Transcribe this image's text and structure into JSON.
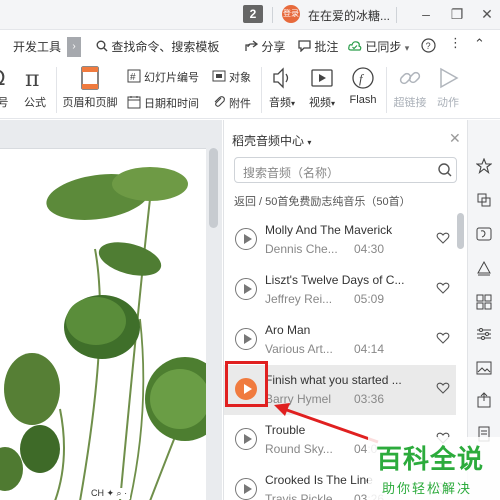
{
  "titlebar": {
    "window_count": "2",
    "avatar_text": "登录",
    "doc_title": "在在爱的冰糖..."
  },
  "menubar": {
    "dev_tools": "开发工具",
    "search_command": "查找命令、搜索模板",
    "share": "分享",
    "comment": "批注",
    "synced": "已同步"
  },
  "ribbon": {
    "partial_left": "号",
    "formula": "公式",
    "header_footer": "页眉和页脚",
    "slide_number": "幻灯片编号",
    "object": "对象",
    "date_time": "日期和时间",
    "attachment": "附件",
    "audio": "音频",
    "video": "视频",
    "flash": "Flash",
    "hyperlink": "超链接",
    "animation": "动作"
  },
  "panel": {
    "title": "稻壳音频中心",
    "search_placeholder": "搜索音频（名称）",
    "breadcrumb": "返回 / 50首免费励志纯音乐（50首）",
    "tracks": [
      {
        "title": "Molly And The Maverick",
        "artist": "Dennis Che...",
        "duration": "04:30"
      },
      {
        "title": "Liszt's Twelve Days of C...",
        "artist": "Jeffrey Rei...",
        "duration": "05:09"
      },
      {
        "title": "Aro Man",
        "artist": "Various Art...",
        "duration": "04:14"
      },
      {
        "title": "Finish what you started ...",
        "artist": "Barry Hymel",
        "duration": "03:36"
      },
      {
        "title": "Trouble",
        "artist": "Round Sky...",
        "duration": "04:0"
      },
      {
        "title": "Crooked Is The Line",
        "artist": "Travis Pickle",
        "duration": "03:26"
      }
    ]
  },
  "statusbar": {
    "ime": "CH"
  },
  "watermark": {
    "main": "百科全说",
    "sub": "助你轻松解决"
  },
  "colors": {
    "accent": "#f07b3f",
    "highlight_box": "#e02020",
    "watermark": "#2cab3c"
  }
}
